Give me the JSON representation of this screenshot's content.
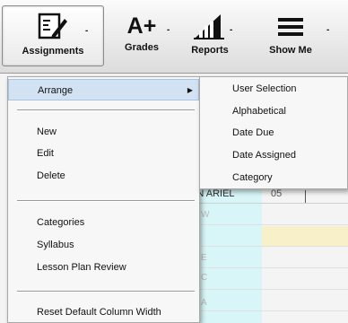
{
  "toolbar": {
    "buttons": [
      {
        "label": "Assignments",
        "icon": "assignments-icon"
      },
      {
        "label": "Grades",
        "icon": "grades-icon",
        "glyph": "A+"
      },
      {
        "label": "Reports",
        "icon": "reports-icon"
      },
      {
        "label": "Show Me",
        "icon": "hamburger-icon"
      }
    ],
    "caret": "-",
    "sep": "-"
  },
  "menu": {
    "items": {
      "arrange": "Arrange",
      "new": "New",
      "edit": "Edit",
      "delete": "Delete",
      "categories": "Categories",
      "syllabus": "Syllabus",
      "lesson_plan_review": "Lesson Plan Review",
      "reset_default_column_width": "Reset Default Column Width"
    },
    "arrow": "▶"
  },
  "submenu": {
    "items": [
      "User Selection",
      "Alphabetical",
      "Date Due",
      "Date Assigned",
      "Category"
    ]
  },
  "grid": {
    "partial_text": "AN ARIEL",
    "partial_num": "05",
    "row_fragments": [
      "W",
      "E",
      "C",
      "A",
      "S"
    ]
  },
  "colors": {
    "highlight": "#d3e2f2",
    "grid_cyan": "#d8f6f8",
    "grid_yellow": "#f8f0c8"
  }
}
